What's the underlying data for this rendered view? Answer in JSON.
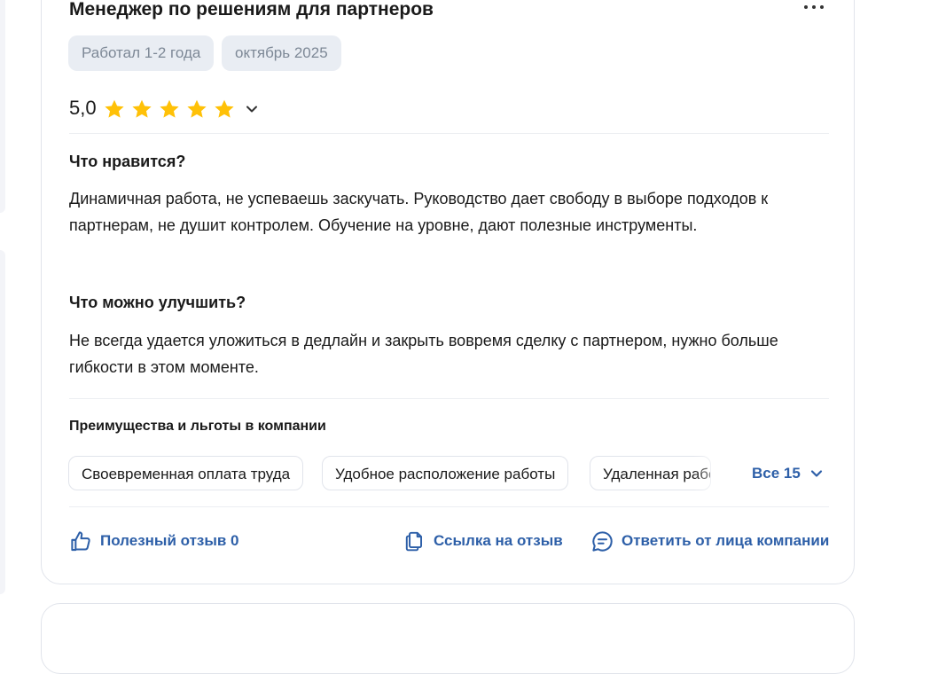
{
  "review": {
    "title": "Менеджер по решениям для партнеров",
    "tags": [
      "Работал 1-2 года",
      "октябрь 2025"
    ],
    "rating": {
      "value": "5,0",
      "stars": 5,
      "max": 5,
      "star_color": "#FFC107"
    },
    "likes": {
      "heading": "Что нравится?",
      "text": "Динамичная работа, не успеваешь заскучать. Руководство дает свободу в выборе подходов к партнерам, не душит контролем. Обучение на уровне, дают полезные инструменты."
    },
    "improve": {
      "heading": "Что можно улучшить?",
      "text": "Не всегда удается уложиться в дедлайн и закрыть вовремя сделку с партнером, нужно больше гибкости в этом моменте."
    },
    "benefits": {
      "heading": "Преимущества и льготы в компании",
      "items": [
        "Своевременная оплата труда",
        "Удобное расположение работы",
        "Удаленная работа"
      ],
      "all_label": "Все 15"
    },
    "actions": {
      "helpful_label": "Полезный отзыв 0",
      "link_label": "Ссылка на отзыв",
      "reply_label": "Ответить от лица компании"
    },
    "accent_color": "#2D5FA8",
    "icons": [
      "more-dots-icon",
      "star-icon",
      "chevron-down-icon",
      "thumbs-up-icon",
      "copy-link-icon",
      "chat-bubble-icon"
    ]
  }
}
